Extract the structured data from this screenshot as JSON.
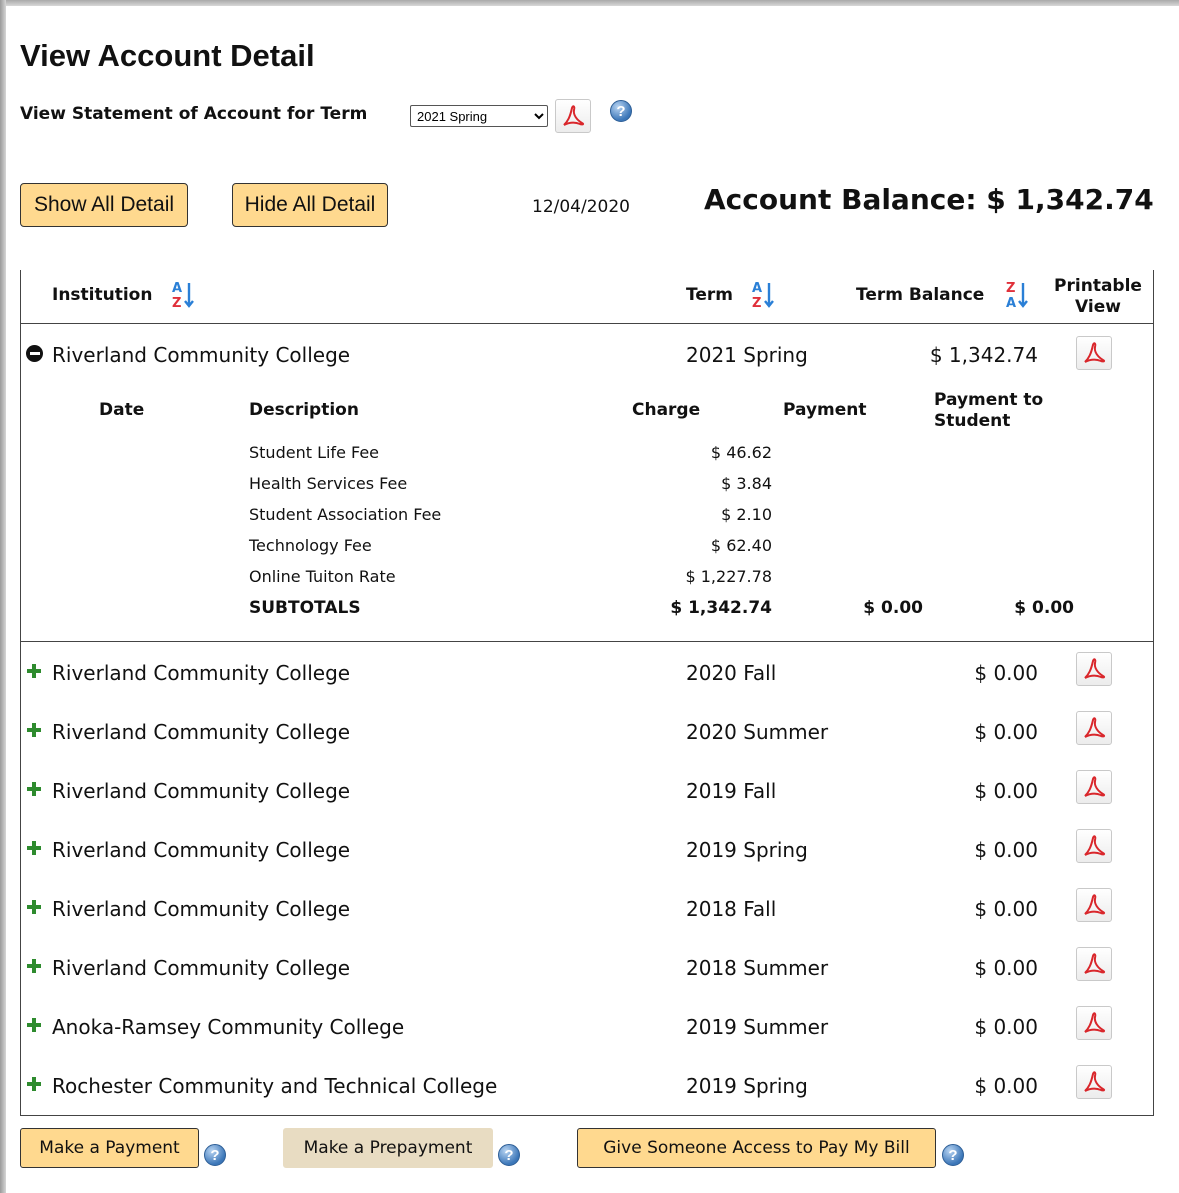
{
  "page": {
    "title": "View Account Detail",
    "term_label": "View Statement of Account for Term",
    "term_selected": "2021 Spring",
    "show_all_label": "Show All Detail",
    "hide_all_label": "Hide All Detail",
    "date": "12/04/2020",
    "balance": "Account Balance: $ 1,342.74"
  },
  "table": {
    "headers": {
      "institution": "Institution",
      "term": "Term",
      "term_balance": "Term Balance",
      "printable_view": "Printable View"
    },
    "expanded": {
      "institution": "Riverland Community College",
      "term": "2021 Spring",
      "balance": "$ 1,342.74",
      "detail_headers": {
        "date": "Date",
        "description": "Description",
        "charge": "Charge",
        "payment": "Payment",
        "payment_to_student": "Payment to Student"
      },
      "items": [
        {
          "description": "Student Life Fee",
          "charge": "$ 46.62"
        },
        {
          "description": "Health Services Fee",
          "charge": "$ 3.84"
        },
        {
          "description": "Student Association Fee",
          "charge": "$ 2.10"
        },
        {
          "description": "Technology Fee",
          "charge": "$ 62.40"
        },
        {
          "description": "Online Tuiton Rate",
          "charge": "$ 1,227.78"
        }
      ],
      "subtotals": {
        "label": "SUBTOTALS",
        "charge": "$ 1,342.74",
        "payment": "$ 0.00",
        "payment_to_student": "$ 0.00"
      }
    },
    "rows": [
      {
        "institution": "Riverland Community College",
        "term": "2020 Fall",
        "balance": "$ 0.00"
      },
      {
        "institution": "Riverland Community College",
        "term": "2020 Summer",
        "balance": "$ 0.00"
      },
      {
        "institution": "Riverland Community College",
        "term": "2019 Fall",
        "balance": "$ 0.00"
      },
      {
        "institution": "Riverland Community College",
        "term": "2019 Spring",
        "balance": "$ 0.00"
      },
      {
        "institution": "Riverland Community College",
        "term": "2018 Fall",
        "balance": "$ 0.00"
      },
      {
        "institution": "Riverland Community College",
        "term": "2018 Summer",
        "balance": "$ 0.00"
      },
      {
        "institution": "Anoka-Ramsey Community College",
        "term": "2019 Summer",
        "balance": "$ 0.00"
      },
      {
        "institution": "Rochester Community and Technical College",
        "term": "2019 Spring",
        "balance": "$ 0.00"
      }
    ]
  },
  "actions": {
    "make_payment": "Make a Payment",
    "make_prepayment": "Make a Prepayment",
    "give_access": "Give Someone Access to Pay My Bill"
  },
  "icons": {
    "pdf": "pdf-icon",
    "help": "help-icon",
    "sort": "sort-icon",
    "expand": "plus-icon",
    "collapse": "minus-icon"
  },
  "colors": {
    "button_bg": "#ffd98f",
    "disabled_button_bg": "#e8dcc2",
    "pdf_red": "#d9262b",
    "sort_blue": "#2a7fd6",
    "sort_red": "#e0303a",
    "plus_green": "#2e8b2e"
  }
}
